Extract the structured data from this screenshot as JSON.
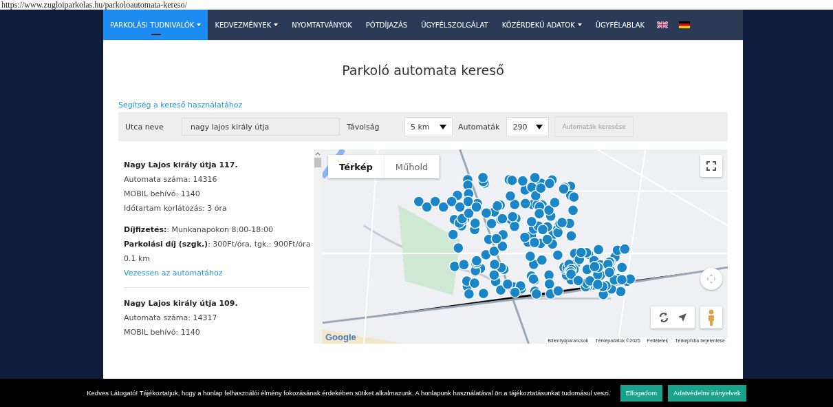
{
  "url_caption": "https://www.zugloiparkolas.hu/parkoloautomata-kereso/",
  "nav": {
    "items": [
      {
        "label": "PARKOLÁSI TUDNIVALÓK",
        "dropdown": true,
        "selected": true
      },
      {
        "label": "KEDVEZMÉNYEK",
        "dropdown": true,
        "selected": false
      },
      {
        "label": "NYOMTATVÁNYOK",
        "dropdown": false,
        "selected": false
      },
      {
        "label": "PÓTDÍJAZÁS",
        "dropdown": false,
        "selected": false
      },
      {
        "label": "ÜGYFÉLSZOLGÁLAT",
        "dropdown": false,
        "selected": false
      },
      {
        "label": "KÖZÉRDEKŰ ADATOK",
        "dropdown": true,
        "selected": false
      },
      {
        "label": "ÜGYFÉLABLAK",
        "dropdown": false,
        "selected": false
      }
    ],
    "languages": [
      {
        "kind": "uk"
      },
      {
        "kind": "de"
      }
    ]
  },
  "page_title": "Parkoló automata kereső",
  "help_link": "Segítség a kereső használatához",
  "search": {
    "street_label": "Utca neve",
    "street_value": "nagy lajos király útja",
    "distance_label": "Távolság",
    "distance_value": "5 km",
    "machines_label": "Automaták",
    "machines_value": "290",
    "button": "Automaták keresése"
  },
  "results": [
    {
      "title": "Nagy Lajos király útja 117.",
      "lines": [
        "Automata száma: 14316",
        "MOBIL behívó: 1140",
        "Időtartam korlátozás: 3 óra"
      ],
      "details": [
        "**Díjfizetés:**: Munkanapokon 8:00-18:00",
        "**Parkolási díj (szgk.)**: 300Ft/óra, tgk.: 900Ft/óra",
        "0.1 km"
      ],
      "link": "Vezessen az automatához"
    },
    {
      "title": "Nagy Lajos király útja 109.",
      "lines": [
        "Automata száma: 14317",
        "MOBIL behívó: 1140"
      ]
    }
  ],
  "map": {
    "tabs": [
      {
        "label": "Térkép",
        "selected": true
      },
      {
        "label": "Műhold",
        "selected": false
      }
    ],
    "logo": "Google",
    "attribution": [
      "Billentyűparancsok",
      "Térképadatok ©2025",
      "Feltételek",
      "Térképhiba bejelentése"
    ]
  },
  "cookie_bar": {
    "text": "Kedves Látogató! Tájékoztatjuk, hogy a honlap felhasználói élmény fokozásának érdekében sütiket alkalmazunk. A honlapunk használatával ön a tájékoztatásunkat tudomásul veszi.",
    "buttons": [
      "Elfogadom",
      "Adatvédelmi irányelvek"
    ]
  }
}
